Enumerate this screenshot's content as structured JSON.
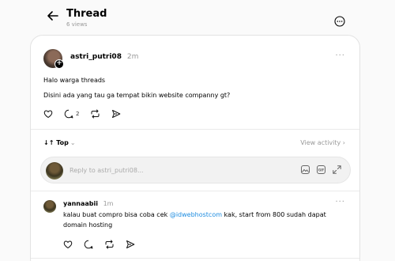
{
  "header": {
    "title": "Thread",
    "views": "6 views"
  },
  "post": {
    "username": "astri_putri08",
    "time": "2m",
    "more": "···",
    "lines": [
      "Halo warga threads",
      "Disini ada yang tau ga tempat bikin website companny gt?"
    ],
    "reply_count": "2"
  },
  "sort": {
    "label": "↓↑ Top",
    "chevron": "⌄",
    "view_activity": "View activity ›"
  },
  "reply_box": {
    "placeholder": "Reply to astri_putri08..."
  },
  "comment": {
    "username": "yannaabii",
    "time": "1m",
    "more": "···",
    "text_before": "kalau buat compro bisa coba cek ",
    "mention": "@idwebhostcom",
    "text_after": " kak, start from 800 sudah dapat domain hosting"
  },
  "icons": {
    "back": "arrow-left-icon",
    "options": "more-circle-icon",
    "like": "heart-icon",
    "comment": "comment-icon",
    "repost": "repost-icon",
    "share": "share-icon",
    "image": "image-icon",
    "gif": "gif-icon",
    "expand": "expand-icon"
  },
  "colors": {
    "mention": "#1d8ce0",
    "muted": "#999999"
  }
}
